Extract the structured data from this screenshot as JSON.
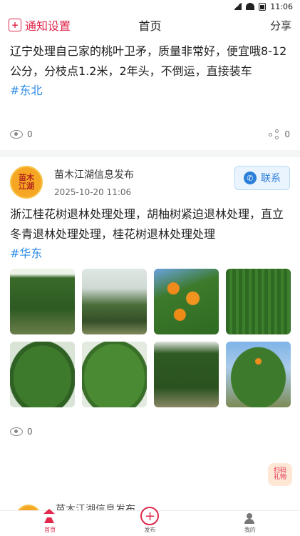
{
  "status_bar": {
    "time": "11:06"
  },
  "top_bar": {
    "notify_label": "通知设置",
    "notify_icon": "plus-square-icon",
    "title": "首页",
    "share_label": "分享"
  },
  "posts": [
    {
      "text": "辽宁处理自己家的桃叶卫矛，质量非常好，便宜哦8-12公分，分枝点1.2米，2年头，不倒运，直接装车",
      "tag": "#东北",
      "views": "0",
      "shares": "0"
    },
    {
      "author": "苗木江湖信息发布",
      "date": "2025-10-20 11:06",
      "contact_label": "联系",
      "avatar_text": "苗木\n江湖",
      "text": "浙江桂花树退林处理处理，胡柚树紧迫退林处理，直立冬青退林处理处理，桂花树退林处理处理",
      "tag": "#华东",
      "views": "0"
    }
  ],
  "next_post": {
    "author": "苗木江湖信息发布"
  },
  "fab": {
    "label": "扫码\n礼物"
  },
  "tabbar": {
    "items": [
      {
        "label": "首页",
        "icon": "home-icon"
      },
      {
        "label": "发布",
        "icon": "plus-circle-icon"
      },
      {
        "label": "我的",
        "icon": "user-icon"
      }
    ]
  },
  "colors": {
    "accent": "#e0284d",
    "link": "#2c8be8"
  }
}
